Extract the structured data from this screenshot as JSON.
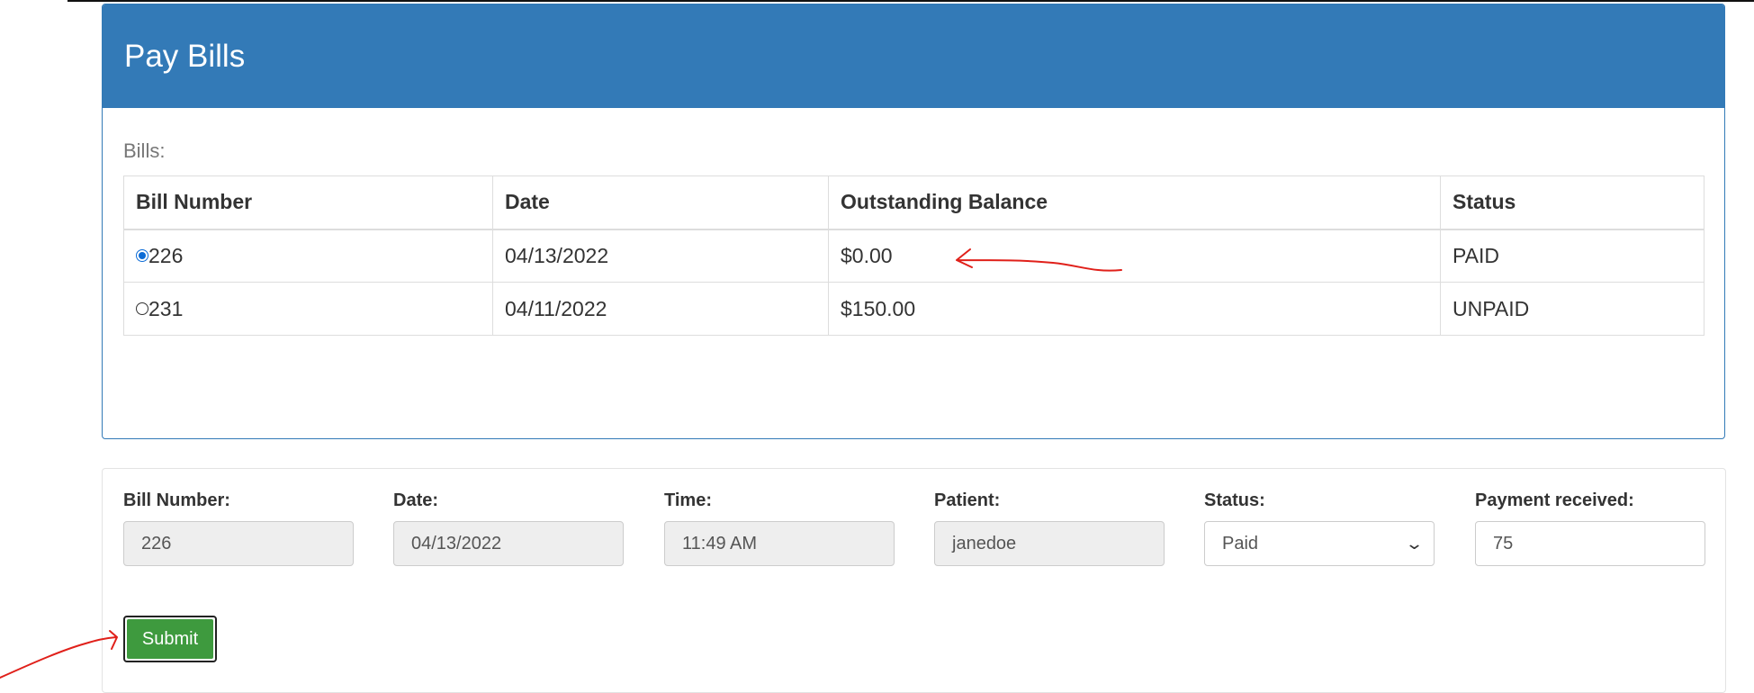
{
  "panel": {
    "title": "Pay Bills",
    "bills_label": "Bills:"
  },
  "bills_table": {
    "headers": [
      "Bill Number",
      "Date",
      "Outstanding Balance",
      "Status"
    ],
    "rows": [
      {
        "bill_number": "226",
        "date": "04/13/2022",
        "balance": "$0.00",
        "status": "PAID",
        "selected": true
      },
      {
        "bill_number": "231",
        "date": "04/11/2022",
        "balance": "$150.00",
        "status": "UNPAID",
        "selected": false
      }
    ]
  },
  "form": {
    "bill_number": {
      "label": "Bill Number:",
      "value": "226"
    },
    "date": {
      "label": "Date:",
      "value": "04/13/2022"
    },
    "time": {
      "label": "Time:",
      "value": "11:49  AM"
    },
    "patient": {
      "label": "Patient:",
      "value": "janedoe"
    },
    "status": {
      "label": "Status:",
      "value": "Paid"
    },
    "payment": {
      "label": "Payment received:",
      "value": "75"
    },
    "submit_label": "Submit"
  },
  "colors": {
    "primary": "#337ab7",
    "success": "#3e9a3e",
    "annotation": "#e0201a"
  },
  "icons": {
    "status_dropdown": "chevron-down-icon"
  }
}
